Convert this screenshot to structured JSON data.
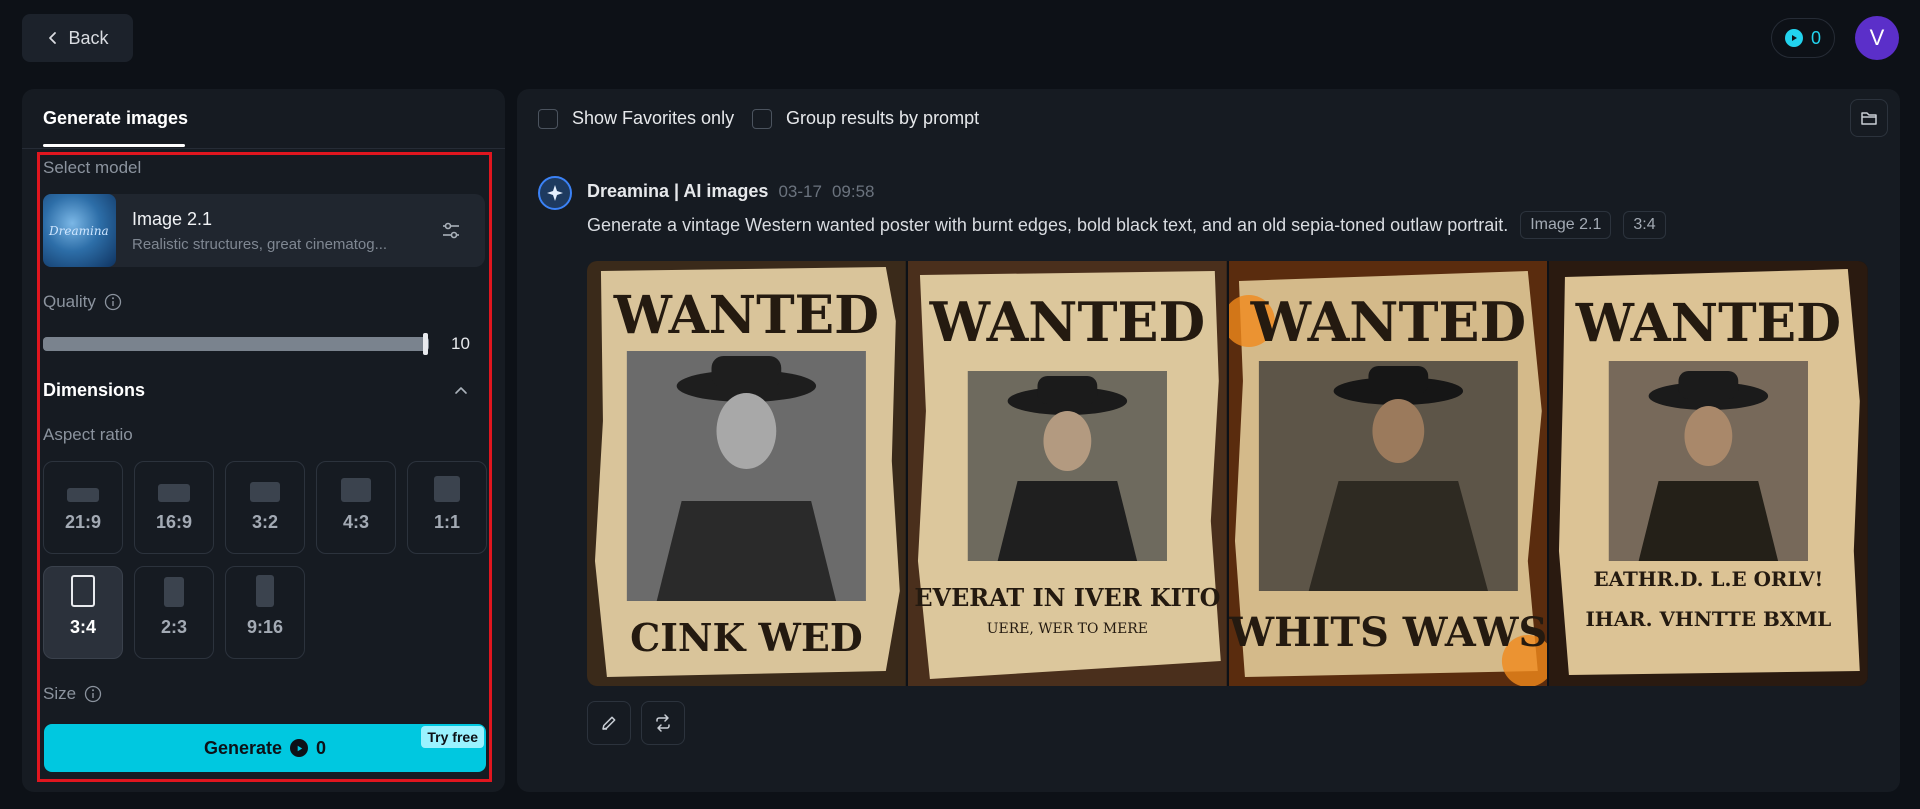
{
  "topbar": {
    "back_label": "Back",
    "credits": "0",
    "avatar_initial": "V"
  },
  "left_panel": {
    "tab": "Generate images",
    "select_model_label": "Select model",
    "model": {
      "thumb_text": "Dreamina",
      "name": "Image 2.1",
      "description": "Realistic structures, great cinematog..."
    },
    "quality_label": "Quality",
    "quality_value": "10",
    "quality_fraction": 1.0,
    "dimensions_title": "Dimensions",
    "aspect_ratio_label": "Aspect ratio",
    "ratios": [
      {
        "label": "21:9",
        "active": false
      },
      {
        "label": "16:9",
        "active": false
      },
      {
        "label": "3:2",
        "active": false
      },
      {
        "label": "4:3",
        "active": false
      },
      {
        "label": "1:1",
        "active": false
      },
      {
        "label": "3:4",
        "active": true
      },
      {
        "label": "2:3",
        "active": false
      },
      {
        "label": "9:16",
        "active": false
      }
    ],
    "size_label": "Size",
    "generate_label": "Generate",
    "generate_cost": "0",
    "try_free_label": "Try free"
  },
  "right_panel": {
    "show_favorites_label": "Show Favorites only",
    "group_results_label": "Group results by prompt",
    "message": {
      "author": "Dreamina | AI images",
      "date": "03-17",
      "time": "09:58",
      "prompt": "Generate a vintage Western wanted poster with burnt edges, bold black text, and an old sepia-toned outlaw portrait.",
      "tags": [
        "Image 2.1",
        "3:4"
      ]
    },
    "posters": [
      {
        "headline": "WANTED",
        "footer": "CINK WED",
        "sub": ""
      },
      {
        "headline": "WANTED",
        "footer": "EVERAT IN IVER KITO",
        "sub": "UERE, WER TO MERE"
      },
      {
        "headline": "WANTED",
        "footer": "WHITS WAWS",
        "sub": ""
      },
      {
        "headline": "WANTED",
        "footer": "EATHR.D. L.E ORLV!",
        "sub": "IHAR. VHNTTE BXML"
      }
    ]
  },
  "colors": {
    "accent": "#00c8e0",
    "highlight": "#e0161f",
    "background": "#0d1117",
    "panel": "#161b22"
  }
}
